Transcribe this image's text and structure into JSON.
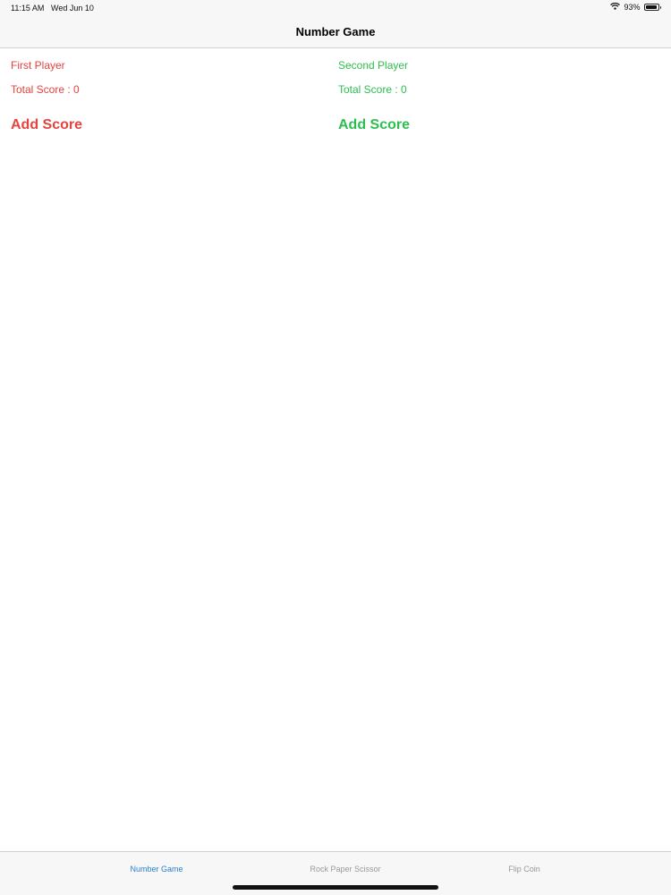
{
  "status_bar": {
    "time": "11:15 AM",
    "date": "Wed Jun 10",
    "battery_percent": "93%",
    "battery_level": 0.93,
    "wifi_icon": "wifi-icon",
    "battery_icon": "battery-icon"
  },
  "nav": {
    "title": "Number Game"
  },
  "players": {
    "first": {
      "name": "First Player",
      "score_text": "Total Score : 0",
      "add_label": "Add Score",
      "color": "#e5433f"
    },
    "second": {
      "name": "Second Player",
      "score_text": "Total Score : 0",
      "add_label": "Add Score",
      "color": "#2dbe4f"
    }
  },
  "tabs": [
    {
      "label": "Number Game",
      "selected": true,
      "color": "#2c7fcf"
    },
    {
      "label": "Rock Paper Scissor",
      "selected": false,
      "color": "#999999"
    },
    {
      "label": "Flip Coin",
      "selected": false,
      "color": "#999999"
    }
  ]
}
